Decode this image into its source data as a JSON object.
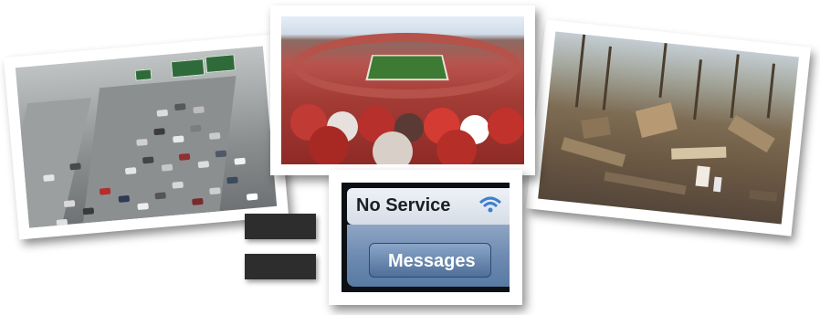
{
  "photos": [
    {
      "name": "traffic-jam-photo"
    },
    {
      "name": "stadium-crowd-photo"
    },
    {
      "name": "storm-damage-photo"
    },
    {
      "name": "phone-no-service-photo"
    }
  ],
  "phone": {
    "status_text": "No Service",
    "button_label": "Messages"
  },
  "colors": {
    "bar": "#2d2d2d",
    "frame": "#ffffff"
  }
}
